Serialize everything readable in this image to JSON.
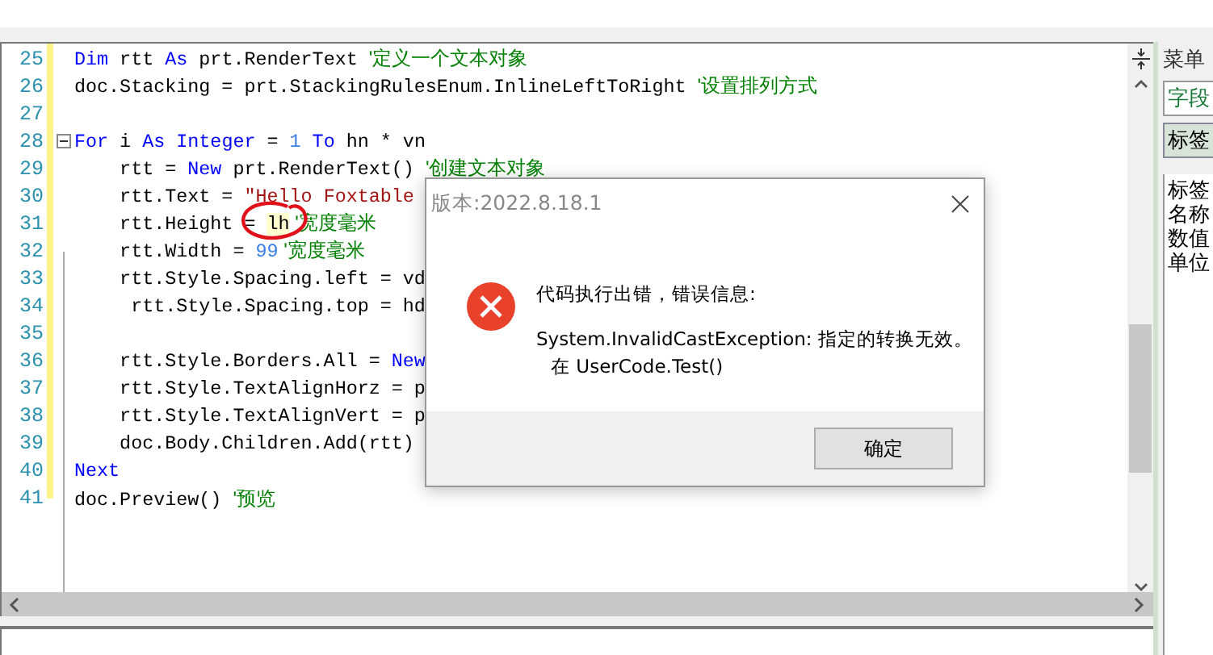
{
  "editor": {
    "lines": [
      {
        "number": "25",
        "tokens": [
          {
            "kind": "keyword",
            "text": "Dim"
          },
          {
            "kind": "plain",
            "text": " rtt "
          },
          {
            "kind": "keyword",
            "text": "As"
          },
          {
            "kind": "plain",
            "text": " prt.RenderText "
          },
          {
            "kind": "comment",
            "text": "'定义一个文本对象"
          }
        ]
      },
      {
        "number": "26",
        "tokens": [
          {
            "kind": "plain",
            "text": "doc.Stacking = prt.StackingRulesEnum.InlineLeftToRight "
          },
          {
            "kind": "comment",
            "text": "'设置排列方式"
          }
        ]
      },
      {
        "number": "27"
      },
      {
        "number": "28",
        "fold": true,
        "tokens": [
          {
            "kind": "keyword",
            "text": "For"
          },
          {
            "kind": "plain",
            "text": " i "
          },
          {
            "kind": "keyword",
            "text": "As Integer"
          },
          {
            "kind": "plain",
            "text": " = "
          },
          {
            "kind": "number",
            "text": "1"
          },
          {
            "kind": "keyword",
            "text": " To"
          },
          {
            "kind": "plain",
            "text": " hn * vn"
          }
        ]
      },
      {
        "number": "29",
        "tokens": [
          {
            "kind": "plain",
            "text": "    rtt = "
          },
          {
            "kind": "keyword",
            "text": "New"
          },
          {
            "kind": "plain",
            "text": " prt.RenderText() "
          },
          {
            "kind": "comment",
            "text": "'创建文本对象"
          }
        ]
      },
      {
        "number": "30",
        "tokens": [
          {
            "kind": "plain",
            "text": "    rtt.Text = "
          },
          {
            "kind": "string",
            "text": "\"Hello Foxtable"
          }
        ]
      },
      {
        "number": "31",
        "tokens": [
          {
            "kind": "plain",
            "text": "    rtt.Height = "
          },
          {
            "kind": "highlight",
            "text": "lh"
          },
          {
            "kind": "comment",
            "text": " '宽度毫米"
          }
        ]
      },
      {
        "number": "32",
        "tokens": [
          {
            "kind": "plain",
            "text": "    rtt.Width = "
          },
          {
            "kind": "number",
            "text": "99"
          },
          {
            "kind": "comment",
            "text": " '宽度毫米"
          }
        ]
      },
      {
        "number": "33",
        "tokens": [
          {
            "kind": "plain",
            "text": "    rtt.Style.Spacing.left = vd"
          }
        ]
      },
      {
        "number": "34",
        "tokens": [
          {
            "kind": "plain",
            "text": "     rtt.Style.Spacing.top = hd"
          }
        ]
      },
      {
        "number": "35"
      },
      {
        "number": "36",
        "tokens": [
          {
            "kind": "plain",
            "text": "    rtt.Style.Borders.All = "
          },
          {
            "kind": "keyword",
            "text": "New"
          }
        ]
      },
      {
        "number": "37",
        "tokens": [
          {
            "kind": "plain",
            "text": "    rtt.Style.TextAlignHorz = p"
          }
        ]
      },
      {
        "number": "38",
        "tokens": [
          {
            "kind": "plain",
            "text": "    rtt.Style.TextAlignVert = p"
          }
        ]
      },
      {
        "number": "39",
        "tokens": [
          {
            "kind": "plain",
            "text": "    doc.Body.Children.Add(rtt)"
          }
        ]
      },
      {
        "number": "40",
        "tokens": [
          {
            "kind": "keyword",
            "text": "Next"
          }
        ]
      },
      {
        "number": "41",
        "tokens": [
          {
            "kind": "plain",
            "text": "doc.Preview() "
          },
          {
            "kind": "comment",
            "text": "'预览"
          }
        ]
      }
    ]
  },
  "side_panel": {
    "title": "菜单",
    "field": "字段",
    "button": "标签",
    "list": [
      "标签",
      "名称",
      "数值",
      "单位"
    ]
  },
  "dialog": {
    "title": "版本:2022.8.18.1",
    "message": "代码执行出错，错误信息:",
    "detail": "System.InvalidCastException: 指定的转换无效。",
    "location": "在 UserCode.Test()",
    "button": "确定"
  }
}
